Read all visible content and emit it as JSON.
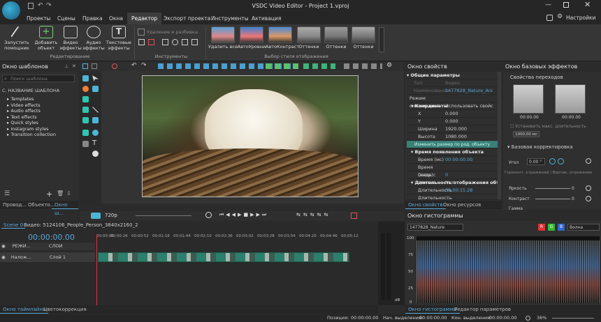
{
  "window": {
    "title": "VSDC Video Editor - Project 1.vproj",
    "settings": "Настройки"
  },
  "menu": [
    "Проекты",
    "Сцены",
    "Правка",
    "Окна",
    "Редактор",
    "Экспорт проекта",
    "Инструменты",
    "Активация"
  ],
  "ribbon": {
    "buttons": [
      {
        "label1": "Запустить",
        "label2": "помощник"
      },
      {
        "label1": "Добавить",
        "label2": "объект"
      },
      {
        "label1": "Видео",
        "label2": "эффекты"
      },
      {
        "label1": "Аудио",
        "label2": "эффекты"
      },
      {
        "label1": "Текстовые",
        "label2": "эффекты"
      }
    ],
    "editing_group": "Редактирование",
    "tools_group": "Инструменты",
    "tools_caption": "Удаление и разбивка",
    "styles_group": "Выбор стиля отображения",
    "styles": [
      "Удалить все",
      "АвтоУровни",
      "АвтоКонтраст",
      "Оттенки",
      "Оттенки",
      "Оттенки"
    ]
  },
  "templates": {
    "title": "Окно шаблонов",
    "search_placeholder": "Поиск шаблона",
    "column": "С. НАЗВАНИЕ ШАБЛОНА",
    "items": [
      "Templates",
      "Video effects",
      "Audio effects",
      "Text effects",
      "Quick styles",
      "Instagram styles",
      "Transition collection"
    ],
    "tabs": [
      "Провод...",
      "Объекто...",
      "Окно ш..."
    ]
  },
  "preview": {
    "quality": "720p"
  },
  "properties": {
    "title": "Окно свойств",
    "section1": "Общие параметры",
    "rows": [
      [
        "Тип",
        "Видео"
      ],
      [
        "Наименование",
        "1477828_Nature_Ani"
      ],
      [
        "Режим смешивания",
        "Использовать свойс"
      ]
    ],
    "coords": "Координаты",
    "coord_rows": [
      [
        "X",
        "0.000"
      ],
      [
        "Y",
        "0.000"
      ],
      [
        "Ширина",
        "1920.000"
      ],
      [
        "Высота",
        "1080.000"
      ]
    ],
    "resize_button": "Изменить размер по род. объекту",
    "appear": "Время появления объекта",
    "appear_rows": [
      [
        "Время (мс)",
        "00:00:00.00"
      ],
      [
        "Время (кадр)",
        "0"
      ],
      [
        "Связь с длител",
        "Нет"
      ]
    ],
    "duration": "Длительность отображения объекта",
    "duration_rows": [
      [
        "Длительность",
        "00:00:15.28"
      ],
      [
        "Длительность",
        "...."
      ]
    ],
    "tabs": [
      "Окно свойств",
      "Окно ресурсов"
    ]
  },
  "basic_effects": {
    "title": "Окно базовых эффектов",
    "transitions": "Свойства переходов",
    "t1": "00:00.00",
    "t2": "00:00.00",
    "max_dur": "Установить макс. длительность",
    "ms": "1000.00 мс",
    "correction": "Базовая корректировка",
    "angle_label": "Угол",
    "angle_value": "0.00 °",
    "flipx": "Горизонт. отражение",
    "flipy": "Вертик. отражение",
    "brightness": "Яркость",
    "contrast": "Контраст",
    "gamma": "Гамма",
    "zero": "0"
  },
  "timeline": {
    "scene_tab": "Scene 0",
    "clip_name": "Видео: 5124106_People_Person_3840x2160_2",
    "time": "00:00:00.00",
    "ruler": [
      "00:00:00",
      "00:00:26",
      "00:00:52",
      "00:01:18",
      "00:01:44",
      "00:02:10",
      "00:02:36",
      "00:03:02",
      "00:03:28",
      "00:03:54",
      "00:04:20",
      "00:04:46",
      "00:05:12"
    ],
    "layers_label": "СЛОИ",
    "mode_label": "РЕЖИ...",
    "overlay_label": "Налож...",
    "layer1": "Слой 1",
    "tabs": [
      "Окно таймлайна",
      "Цветокоррекция"
    ]
  },
  "meter": {
    "db": "dB",
    "marks": [
      "0",
      "6",
      "12",
      "18",
      "24",
      "30",
      "36",
      "42",
      "48",
      "54"
    ]
  },
  "histogram": {
    "title": "Окно гистограммы",
    "source": "1477828_Nature",
    "mode": "Волна",
    "channels": [
      "R",
      "G",
      "B"
    ],
    "scale": [
      "100",
      "75",
      "50",
      "25",
      "0"
    ],
    "tabs": [
      "Окно гистограммы",
      "Редактор параметров"
    ]
  },
  "status": {
    "position_label": "Позиция:",
    "position": "00:00:00.00",
    "start_label": "Нач. выделения:",
    "start": "00:00:00.00",
    "end_label": "Кон. выделения:",
    "end": "00:00:00.00",
    "zoom": "36%"
  }
}
